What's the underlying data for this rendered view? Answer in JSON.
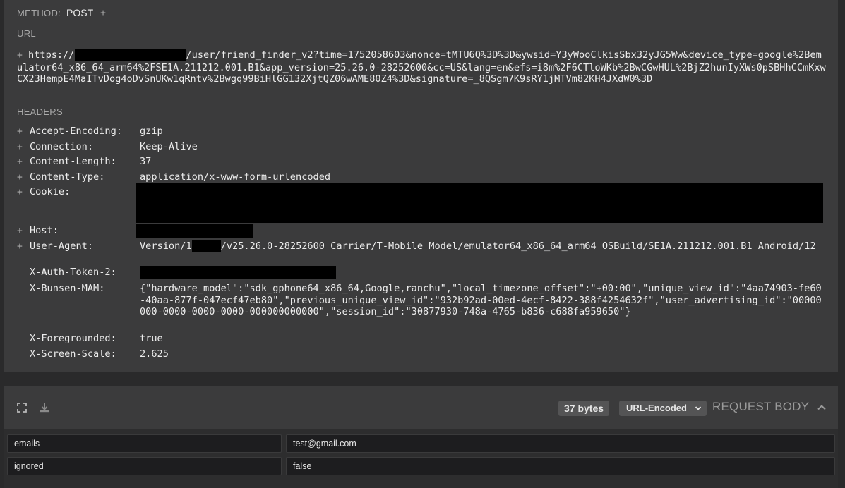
{
  "method": {
    "label": "METHOD:",
    "value": "POST",
    "add": "+"
  },
  "url": {
    "label": "URL",
    "prefix": "https://",
    "rest": "/user/friend_finder_v2?time=1752058603&nonce=tMTU6Q%3D%3D&ywsid=Y3yWooClkisSbx32yJG5Ww&device_type=google%2Bemulator64_x86_64_arm64%2FSE1A.211212.001.B1&app_version=25.26.0-28252600&cc=US&lang=en&efs=i8m%2F6CTloWKb%2BwCGwHUL%2BjZ2hunIyXWs0pSBHhCCmKxwCX23HempE4MaITvDog4oDvSnUKw1qRntv%2Bwgq99BiHlGG132XjtQZ06wAME80Z4%3D&signature=_8QSgm7K9sRY1jMTVm82KH4JXdW0%3D"
  },
  "headers": {
    "label": "HEADERS",
    "accept_encoding": {
      "name": "Accept-Encoding:",
      "value": "gzip"
    },
    "connection": {
      "name": "Connection:",
      "value": "Keep-Alive"
    },
    "content_length": {
      "name": "Content-Length:",
      "value": "37"
    },
    "content_type": {
      "name": "Content-Type:",
      "value": "application/x-www-form-urlencoded"
    },
    "cookie": {
      "name": "Cookie:"
    },
    "host": {
      "name": "Host:"
    },
    "user_agent": {
      "name": "User-Agent:",
      "value_a": "Version/1",
      "value_b": "/v25.26.0-28252600 Carrier/T-Mobile Model/emulator64_x86_64_arm64 OSBuild/SE1A.211212.001.B1 Android/12"
    },
    "auth_token": {
      "name": "X-Auth-Token-2:"
    },
    "bunsen": {
      "name": "X-Bunsen-MAM:",
      "value": "{\"hardware_model\":\"sdk_gphone64_x86_64,Google,ranchu\",\"local_timezone_offset\":\"+00:00\",\"unique_view_id\":\"4aa74903-fe60-40aa-877f-047ecf47eb80\",\"previous_unique_view_id\":\"932b92ad-00ed-4ecf-8422-388f4254632f\",\"user_advertising_id\":\"00000000-0000-0000-0000-000000000000\",\"session_id\":\"30877930-748a-4765-b836-c688fa959650\"}"
    },
    "foregrounded": {
      "name": "X-Foregrounded:",
      "value": "true"
    },
    "screen_scale": {
      "name": "X-Screen-Scale:",
      "value": "2.625"
    }
  },
  "request_body": {
    "size": "37 bytes",
    "encoding": "URL-Encoded",
    "title": "REQUEST BODY",
    "rows": [
      {
        "key": "emails",
        "value": "test@gmail.com"
      },
      {
        "key": "ignored",
        "value": "false"
      }
    ]
  }
}
